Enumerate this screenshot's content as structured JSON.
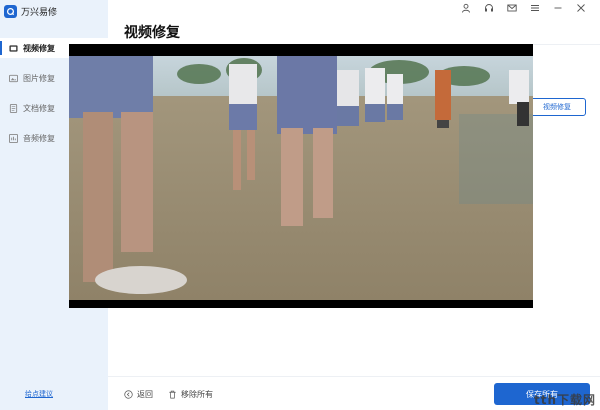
{
  "app": {
    "title": "万兴易修"
  },
  "sidebar": {
    "items": [
      {
        "label": "视频修复",
        "icon": "video-icon",
        "active": true
      },
      {
        "label": "图片修复",
        "icon": "image-icon",
        "active": false
      },
      {
        "label": "文档修复",
        "icon": "document-icon",
        "active": false
      },
      {
        "label": "音频修复",
        "icon": "audio-icon",
        "active": false
      }
    ],
    "feedback_label": "给点建议"
  },
  "titlebar": {
    "icons": [
      "user-icon",
      "headset-icon",
      "mail-icon",
      "menu-icon",
      "minimize-icon",
      "close-icon"
    ]
  },
  "main": {
    "title": "视频修复",
    "behind_button_label": "视频修复"
  },
  "footer": {
    "back_label": "返回",
    "remove_all_label": "移除所有",
    "save_all_label": "保存所有"
  },
  "watermark": "tth下载网",
  "colors": {
    "accent": "#1e66d0",
    "sidebar_bg": "#eaf2fb"
  }
}
